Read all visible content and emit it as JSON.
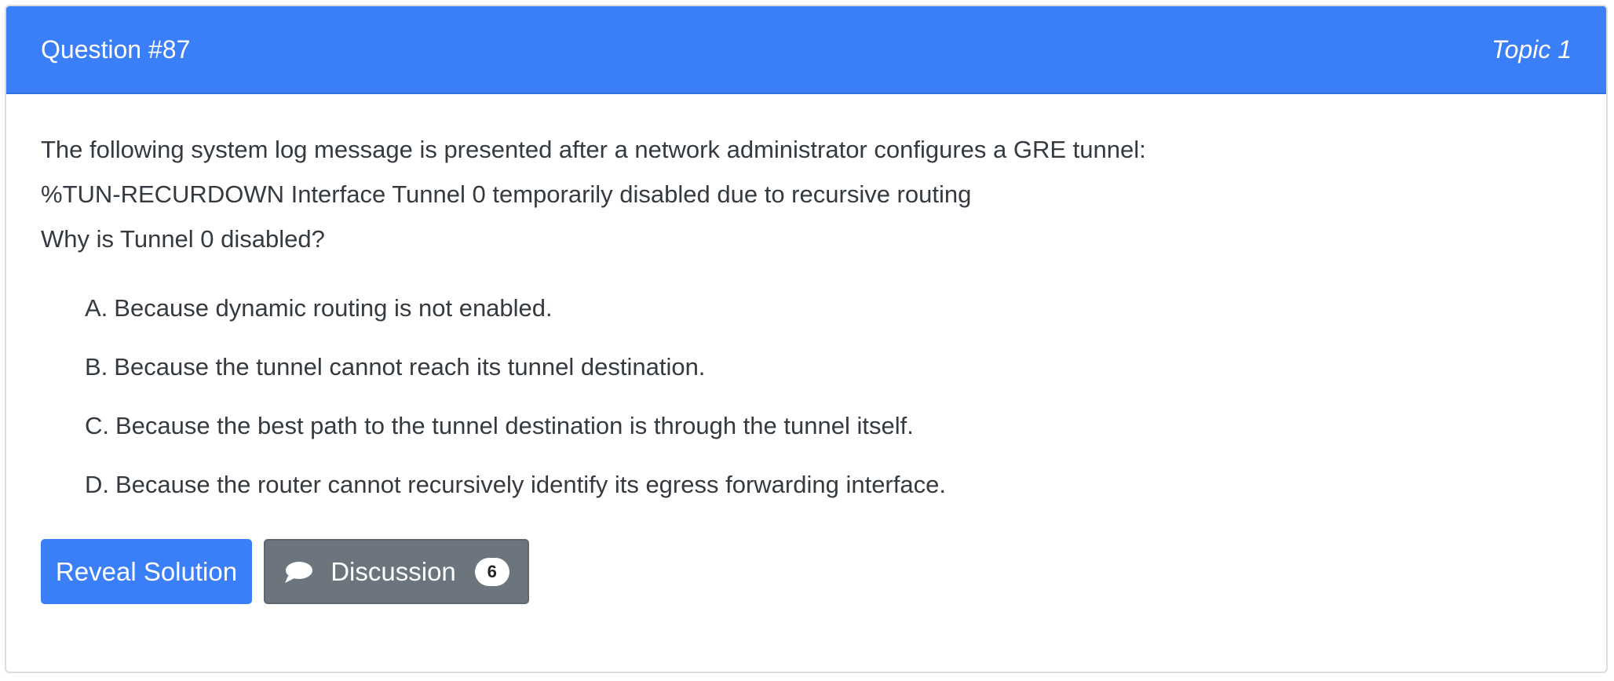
{
  "question": {
    "number_label": "Question #87",
    "topic_label": "Topic 1",
    "text_lines": [
      "The following system log message is presented after a network administrator configures a GRE tunnel:",
      "%TUN-RECURDOWN Interface Tunnel 0 temporarily disabled due to recursive routing",
      "Why is Tunnel 0 disabled?"
    ],
    "choices": [
      {
        "letter": "A.",
        "text": "Because dynamic routing is not enabled."
      },
      {
        "letter": "B.",
        "text": "Because the tunnel cannot reach its tunnel destination."
      },
      {
        "letter": "C.",
        "text": "Because the best path to the tunnel destination is through the tunnel itself."
      },
      {
        "letter": "D.",
        "text": "Because the router cannot recursively identify its egress forwarding interface."
      }
    ]
  },
  "actions": {
    "reveal_label": "Reveal Solution",
    "discussion_label": "Discussion",
    "discussion_count": "6",
    "discussion_icon": "chat-bubble-icon"
  },
  "colors": {
    "header_bg": "#3a7ef8",
    "primary_button": "#3a7ef8",
    "secondary_button": "#6c757d"
  }
}
